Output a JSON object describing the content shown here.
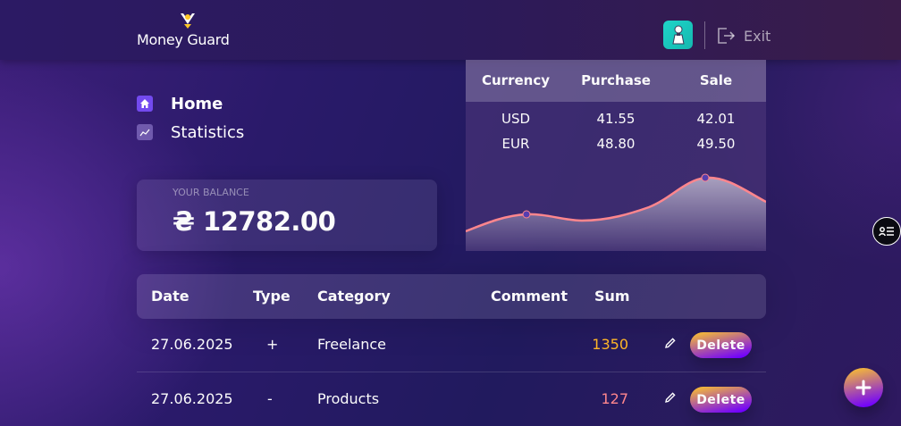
{
  "app": {
    "name": "Money Guard"
  },
  "header": {
    "exit_label": "Exit"
  },
  "nav": {
    "items": [
      {
        "label": "Home",
        "active": true,
        "icon": "home-icon"
      },
      {
        "label": "Statistics",
        "active": false,
        "icon": "chart-icon"
      }
    ]
  },
  "balance": {
    "label": "YOUR BALANCE",
    "value": "₴ 12782.00"
  },
  "currency": {
    "headers": [
      "Currency",
      "Purchase",
      "Sale"
    ],
    "rows": [
      [
        "USD",
        "41.55",
        "42.01"
      ],
      [
        "EUR",
        "48.80",
        "49.50"
      ]
    ]
  },
  "transactions": {
    "headers": {
      "date": "Date",
      "type": "Type",
      "category": "Category",
      "comment": "Comment",
      "sum": "Sum"
    },
    "rows": [
      {
        "date": "27.06.2025",
        "type": "+",
        "category": "Freelance",
        "comment": "",
        "sum": "1350",
        "delete": "Delete"
      },
      {
        "date": "27.06.2025",
        "type": "-",
        "category": "Products",
        "comment": "",
        "sum": "127",
        "delete": "Delete"
      }
    ]
  },
  "colors": {
    "income": "#ffb627",
    "expense": "#ff868d",
    "accent": "#734aef",
    "chart_line": "#ff868d"
  }
}
